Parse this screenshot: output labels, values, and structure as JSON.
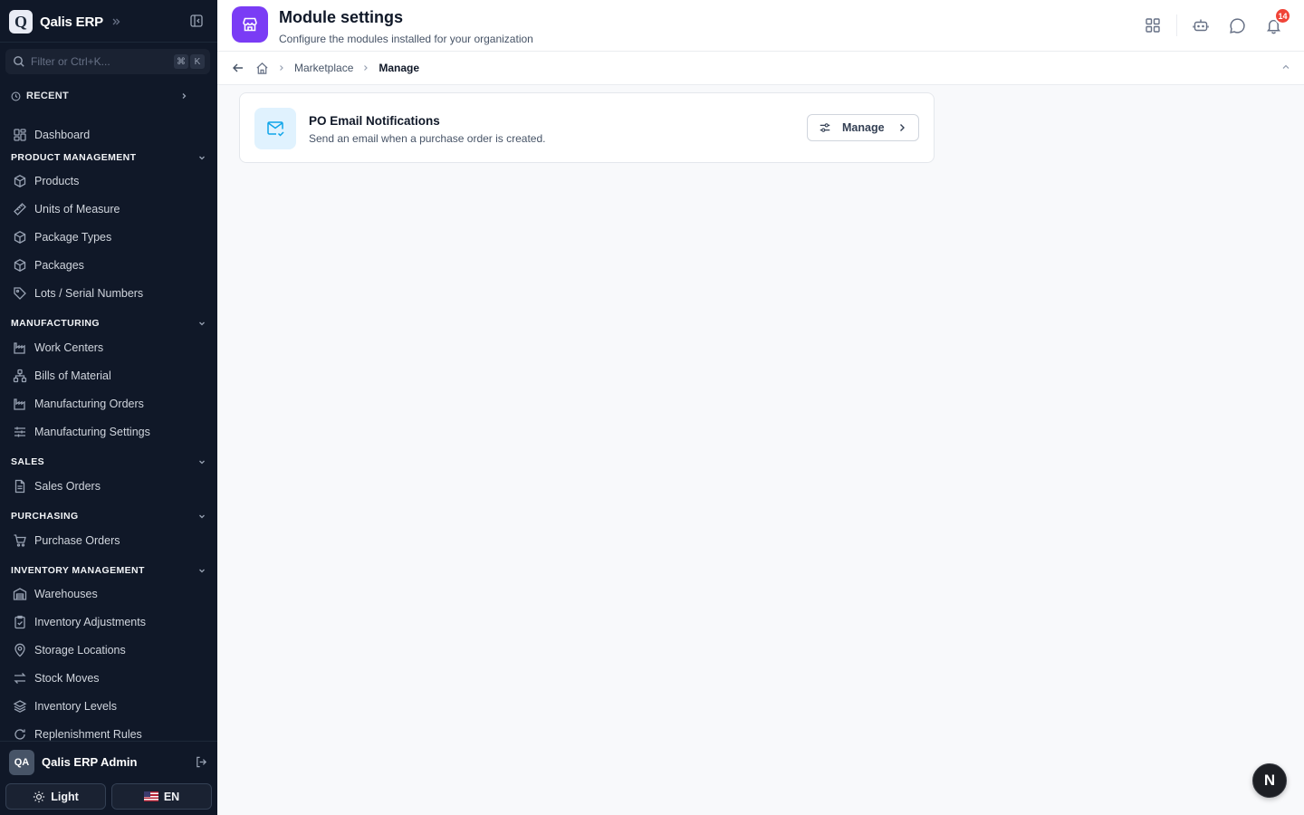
{
  "brand": {
    "logo_letter": "Q",
    "name": "Qalis ERP"
  },
  "search": {
    "placeholder": "Filter or Ctrl+K...",
    "value": "",
    "kbd_mod": "⌘",
    "kbd_key": "K"
  },
  "recent": {
    "label": "RECENT"
  },
  "nav": {
    "dashboard": "Dashboard",
    "sections": {
      "product_management": "PRODUCT MANAGEMENT",
      "manufacturing": "MANUFACTURING",
      "sales": "SALES",
      "purchasing": "PURCHASING",
      "inventory_management": "INVENTORY MANAGEMENT"
    },
    "items": {
      "products": "Products",
      "units_of_measure": "Units of Measure",
      "package_types": "Package Types",
      "packages": "Packages",
      "lots_serial_numbers": "Lots / Serial Numbers",
      "work_centers": "Work Centers",
      "bills_of_material": "Bills of Material",
      "manufacturing_orders": "Manufacturing Orders",
      "manufacturing_settings": "Manufacturing Settings",
      "sales_orders": "Sales Orders",
      "purchase_orders": "Purchase Orders",
      "warehouses": "Warehouses",
      "inventory_adjustments": "Inventory Adjustments",
      "storage_locations": "Storage Locations",
      "stock_moves": "Stock Moves",
      "inventory_levels": "Inventory Levels",
      "replenishment_rules": "Replenishment Rules"
    }
  },
  "user": {
    "initials": "QA",
    "name": "Qalis ERP Admin"
  },
  "footer": {
    "theme_label": "Light",
    "language_label": "EN"
  },
  "header": {
    "title": "Module settings",
    "subtitle": "Configure the modules installed for your organization",
    "notification_count": "14",
    "accent_color": "#7a3cf5"
  },
  "breadcrumb": {
    "items": [
      "Marketplace",
      "Manage"
    ]
  },
  "module": {
    "title": "PO Email Notifications",
    "description": "Send an email when a purchase order is created.",
    "button_label": "Manage"
  },
  "fab": {
    "letter": "N"
  }
}
